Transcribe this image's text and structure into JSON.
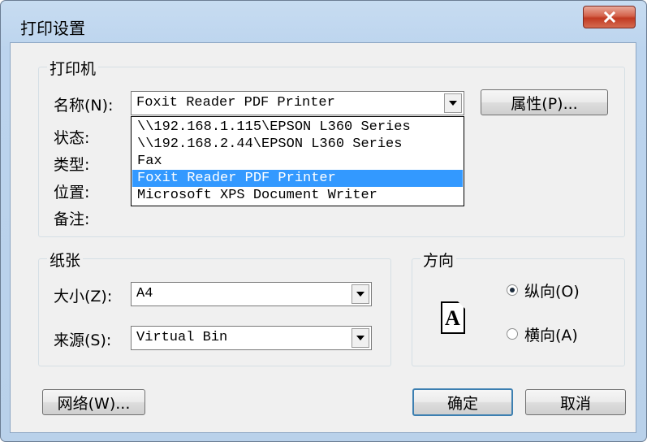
{
  "dialog": {
    "title": "打印设置",
    "close_label": "x"
  },
  "printer": {
    "group_label": "打印机",
    "name_label": "名称(N):",
    "selected": "Foxit Reader PDF Printer",
    "properties_button": "属性(P)...",
    "status_label": "状态:",
    "type_label": "类型:",
    "location_label": "位置:",
    "comment_label": "备注:",
    "options": [
      "\\\\192.168.1.115\\EPSON L360 Series",
      "\\\\192.168.2.44\\EPSON L360 Series",
      "Fax",
      "Foxit Reader PDF Printer",
      "Microsoft XPS Document Writer"
    ],
    "highlighted_option": "Foxit Reader PDF Printer"
  },
  "paper": {
    "group_label": "纸张",
    "size_label": "大小(Z):",
    "size_value": "A4",
    "source_label": "来源(S):",
    "source_value": "Virtual Bin"
  },
  "orientation": {
    "group_label": "方向",
    "icon_letter": "A",
    "portrait_label": "纵向(O)",
    "landscape_label": "横向(A)",
    "selected": "portrait"
  },
  "buttons": {
    "network": "网络(W)...",
    "ok": "确定",
    "cancel": "取消"
  },
  "colors": {
    "selection": "#3399ff",
    "close_button": "#c13a22"
  }
}
